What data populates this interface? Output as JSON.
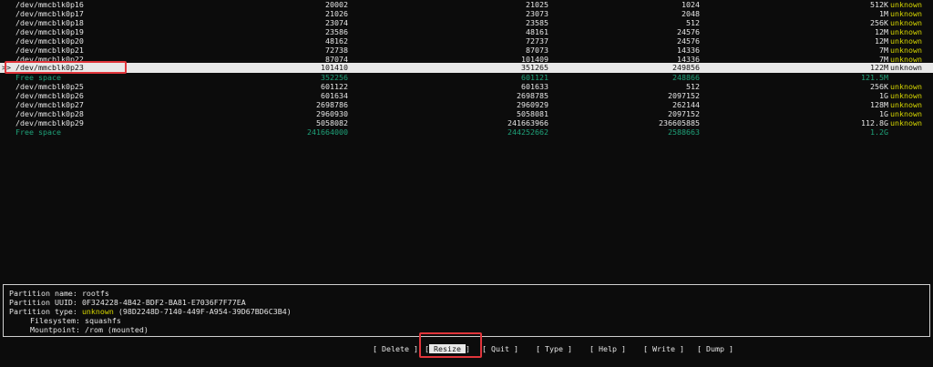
{
  "partitions": [
    {
      "device": "/dev/mmcblk0p16",
      "start": "20002",
      "end": "21025",
      "sectors": "1024",
      "size": "512K",
      "type": "unknown"
    },
    {
      "device": "/dev/mmcblk0p17",
      "start": "21026",
      "end": "23073",
      "sectors": "2048",
      "size": "1M",
      "type": "unknown"
    },
    {
      "device": "/dev/mmcblk0p18",
      "start": "23074",
      "end": "23585",
      "sectors": "512",
      "size": "256K",
      "type": "unknown"
    },
    {
      "device": "/dev/mmcblk0p19",
      "start": "23586",
      "end": "48161",
      "sectors": "24576",
      "size": "12M",
      "type": "unknown"
    },
    {
      "device": "/dev/mmcblk0p20",
      "start": "48162",
      "end": "72737",
      "sectors": "24576",
      "size": "12M",
      "type": "unknown"
    },
    {
      "device": "/dev/mmcblk0p21",
      "start": "72738",
      "end": "87073",
      "sectors": "14336",
      "size": "7M",
      "type": "unknown"
    },
    {
      "device": "/dev/mmcblk0p22",
      "start": "87074",
      "end": "101409",
      "sectors": "14336",
      "size": "7M",
      "type": "unknown"
    },
    {
      "device": "/dev/mmcblk0p23",
      "start": "101410",
      "end": "351265",
      "sectors": "249856",
      "size": "122M",
      "type": "unknown"
    },
    {
      "device": "Free space",
      "start": "352256",
      "end": "601121",
      "sectors": "248866",
      "size": "121.5M",
      "type": ""
    },
    {
      "device": "/dev/mmcblk0p25",
      "start": "601122",
      "end": "601633",
      "sectors": "512",
      "size": "256K",
      "type": "unknown"
    },
    {
      "device": "/dev/mmcblk0p26",
      "start": "601634",
      "end": "2698785",
      "sectors": "2097152",
      "size": "1G",
      "type": "unknown"
    },
    {
      "device": "/dev/mmcblk0p27",
      "start": "2698786",
      "end": "2960929",
      "sectors": "262144",
      "size": "128M",
      "type": "unknown"
    },
    {
      "device": "/dev/mmcblk0p28",
      "start": "2960930",
      "end": "5058081",
      "sectors": "2097152",
      "size": "1G",
      "type": "unknown"
    },
    {
      "device": "/dev/mmcblk0p29",
      "start": "5058082",
      "end": "241663966",
      "sectors": "236605885",
      "size": "112.8G",
      "type": "unknown"
    },
    {
      "device": "Free space",
      "start": "241664000",
      "end": "244252662",
      "sectors": "2588663",
      "size": "1.2G",
      "type": ""
    }
  ],
  "selected_row_marker": ">>",
  "details": {
    "name_label": "Partition name:",
    "name_value": "rootfs",
    "uuid_label": "Partition UUID:",
    "uuid_value": "0F324228-4B42-BDF2-BA81-E7036F7F77EA",
    "type_label": "Partition type:",
    "type_value": "unknown",
    "type_guid": "(98D2248D-7140-449F-A954-39D67BD6C3B4)",
    "fs_label": "Filesystem:",
    "fs_value": "squashfs",
    "mount_label": "Mountpoint:",
    "mount_value": "/rom (mounted)"
  },
  "menu": [
    {
      "label": "Delete"
    },
    {
      "label": "Resize"
    },
    {
      "label": "Quit"
    },
    {
      "label": "Type"
    },
    {
      "label": "Help"
    },
    {
      "label": "Write"
    },
    {
      "label": "Dump"
    }
  ],
  "colors": {
    "free_space": "#1fa37a",
    "type_unknown": "#d7d700",
    "highlight_box": "#e0353b",
    "selection_bg": "#e8e8e8"
  }
}
